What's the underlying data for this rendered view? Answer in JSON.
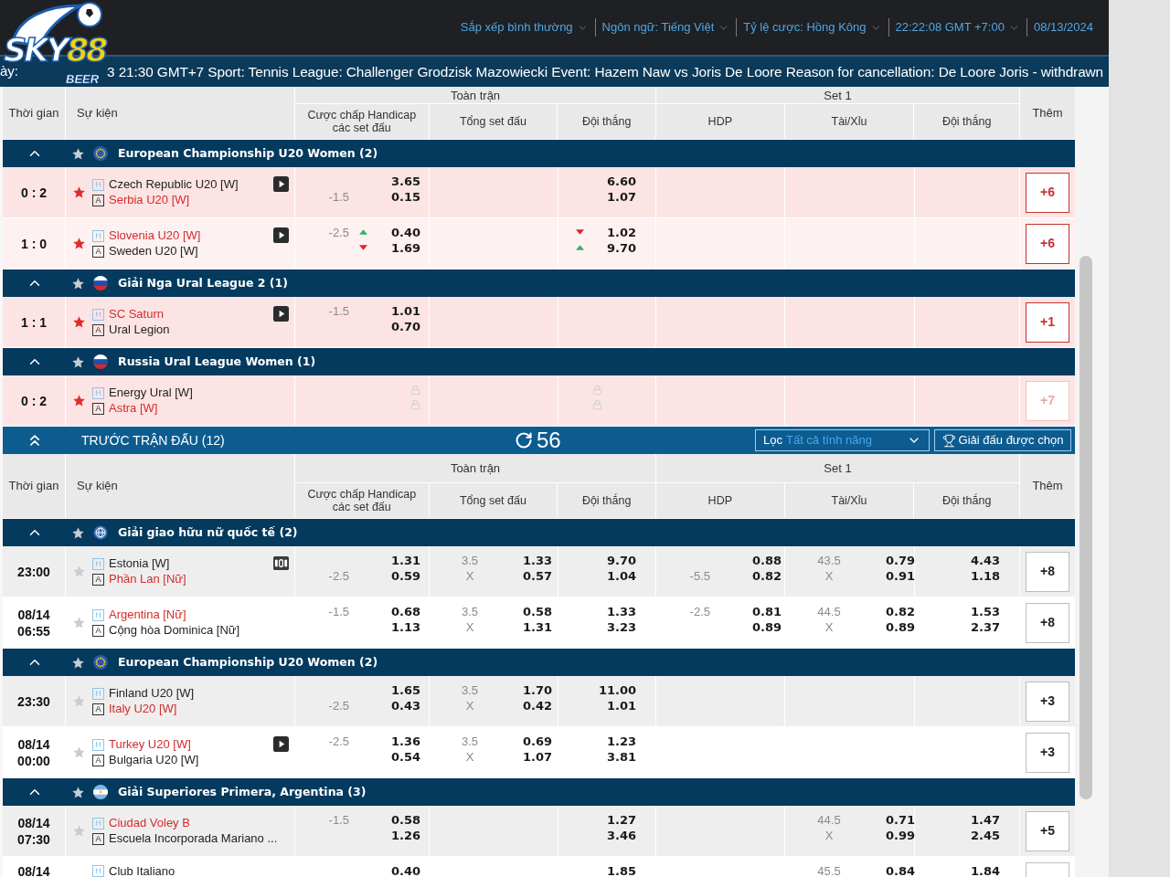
{
  "logo": {
    "brand": "SKY",
    "number": "88",
    "tagline": "BEER"
  },
  "top_menu": [
    {
      "label": "Sắp xếp bình thường",
      "dropdown": true
    },
    {
      "label": "Ngôn ngữ: Tiếng Việt",
      "dropdown": true
    },
    {
      "label": "Tỷ lệ cược: Hồng Kông",
      "dropdown": true
    },
    {
      "label": "22:22:08 GMT +7:00",
      "dropdown": true
    },
    {
      "label": "08/13/2024",
      "dropdown": false
    }
  ],
  "ticker": {
    "lead": "ày:",
    "text": "3 21:30 GMT+7 Sport: Tennis League: Challenger Grodzisk Mazowiecki Event: Hazem Naw vs Joris De Loore Reason for cancellation: De Loore Joris - withdrawn"
  },
  "sections": [
    {
      "kind": "live",
      "header": {
        "time": "Thời gian",
        "event": "Sự kiện",
        "groups": [
          {
            "label": "Toàn trận",
            "columns": [
              "Cược chấp Handicap các set đấu",
              "Tổng set đấu",
              "Đội thắng"
            ]
          },
          {
            "label": "Set 1",
            "columns": [
              "HDP",
              "Tài/Xỉu",
              "Đội thắng"
            ]
          }
        ],
        "more": "Thêm"
      },
      "leagues": [
        {
          "title": "European Championship U20 Women (2)",
          "flag": {
            "kind": "eu"
          },
          "matches": [
            {
              "score": "0 : 2",
              "starred": true,
              "media": {
                "kind": "video"
              },
              "teams": [
                {
                  "tag": "H",
                  "name": "Czech Republic U20 [W]",
                  "favorite": false
                },
                {
                  "tag": "A",
                  "name": "Serbia U20 [W]",
                  "favorite": true
                }
              ],
              "ft_hdp": {
                "line_away": "-1.5",
                "odds": [
                  {
                    "value": "3.65"
                  },
                  {
                    "value": "0.15"
                  }
                ]
              },
              "ft_win": {
                "odds": [
                  {
                    "value": "6.60"
                  },
                  {
                    "value": "1.07"
                  }
                ]
              },
              "more": {
                "label": "+6",
                "disabled": false
              }
            },
            {
              "score": "1 : 0",
              "starred": true,
              "media": {
                "kind": "video"
              },
              "teams": [
                {
                  "tag": "H",
                  "name": "Slovenia U20 [W]",
                  "favorite": true
                },
                {
                  "tag": "A",
                  "name": "Sweden U20 [W]",
                  "favorite": false
                }
              ],
              "ft_hdp": {
                "line_home": "-2.5",
                "odds": [
                  {
                    "value": "0.40",
                    "rising": true
                  },
                  {
                    "value": "1.69",
                    "falling": true
                  }
                ]
              },
              "ft_win": {
                "odds": [
                  {
                    "value": "1.02",
                    "falling": true
                  },
                  {
                    "value": "9.70",
                    "rising": true
                  }
                ]
              },
              "more": {
                "label": "+6",
                "disabled": false
              }
            }
          ]
        },
        {
          "title": "Giải Nga Ural League 2 (1)",
          "flag": {
            "kind": "ru"
          },
          "matches": [
            {
              "score": "1 : 1",
              "starred": true,
              "media": {
                "kind": "video"
              },
              "teams": [
                {
                  "tag": "H",
                  "name": "SC Saturn",
                  "favorite": true
                },
                {
                  "tag": "A",
                  "name": "Ural Legion",
                  "favorite": false
                }
              ],
              "ft_hdp": {
                "line_home": "-1.5",
                "odds": [
                  {
                    "value": "1.01"
                  },
                  {
                    "value": "0.70"
                  }
                ]
              },
              "more": {
                "label": "+1",
                "disabled": false
              }
            }
          ]
        },
        {
          "title": "Russia Ural League Women (1)",
          "flag": {
            "kind": "ru"
          },
          "matches": [
            {
              "score": "0 : 2",
              "starred": true,
              "teams": [
                {
                  "tag": "H",
                  "name": "Energy Ural [W]",
                  "favorite": false
                },
                {
                  "tag": "A",
                  "name": "Astra [W]",
                  "favorite": true
                }
              ],
              "ft_hdp": {
                "locked": true
              },
              "ft_win": {
                "locked": true
              },
              "more": {
                "label": "+7",
                "disabled": true
              }
            }
          ]
        }
      ]
    },
    {
      "kind": "upcoming",
      "bar": {
        "title": "TRƯỚC TRẬN ĐẤU (12)",
        "refresh": "56",
        "filter": {
          "label": "Lọc",
          "value": "Tất cả tính năng"
        },
        "leagues_button": "Giải đấu được chọn"
      },
      "header": {
        "time": "Thời gian",
        "event": "Sự kiện",
        "groups": [
          {
            "label": "Toàn trận",
            "columns": [
              "Cược chấp Handicap các set đấu",
              "Tổng set đấu",
              "Đội thắng"
            ]
          },
          {
            "label": "Set 1",
            "columns": [
              "HDP",
              "Tài/Xỉu",
              "Đội thắng"
            ]
          }
        ],
        "more": "Thêm"
      },
      "leagues": [
        {
          "title": "Giải giao hữu nữ quốc tế (2)",
          "flag": {
            "kind": "globe"
          },
          "matches": [
            {
              "start": [
                "23:00"
              ],
              "starred": false,
              "media": {
                "kind": "stats"
              },
              "teams": [
                {
                  "tag": "H",
                  "name": "Estonia [W]",
                  "favorite": false
                },
                {
                  "tag": "A",
                  "name": "Phần Lan [Nữ]",
                  "favorite": true
                }
              ],
              "ft_hdp": {
                "line_away": "-2.5",
                "odds": [
                  {
                    "value": "1.31"
                  },
                  {
                    "value": "0.59"
                  }
                ]
              },
              "ft_total": {
                "line": "3.5",
                "mark": "X",
                "odds": [
                  {
                    "value": "1.33"
                  },
                  {
                    "value": "0.57"
                  }
                ]
              },
              "ft_win": {
                "odds": [
                  {
                    "value": "9.70"
                  },
                  {
                    "value": "1.04"
                  }
                ]
              },
              "s1_hdp": {
                "line_away": "-5.5",
                "odds": [
                  {
                    "value": "0.88"
                  },
                  {
                    "value": "0.82"
                  }
                ]
              },
              "s1_total": {
                "line": "43.5",
                "mark": "X",
                "odds": [
                  {
                    "value": "0.79"
                  },
                  {
                    "value": "0.91"
                  }
                ]
              },
              "s1_win": {
                "odds": [
                  {
                    "value": "4.43"
                  },
                  {
                    "value": "1.18"
                  }
                ]
              },
              "more": {
                "label": "+8",
                "disabled": false
              }
            },
            {
              "start": [
                "08/14",
                "06:55"
              ],
              "starred": false,
              "teams": [
                {
                  "tag": "H",
                  "name": "Argentina [Nữ]",
                  "favorite": true
                },
                {
                  "tag": "A",
                  "name": "Cộng hòa Dominica [Nữ]",
                  "favorite": false
                }
              ],
              "ft_hdp": {
                "line_home": "-1.5",
                "odds": [
                  {
                    "value": "0.68"
                  },
                  {
                    "value": "1.13"
                  }
                ]
              },
              "ft_total": {
                "line": "3.5",
                "mark": "X",
                "odds": [
                  {
                    "value": "0.58"
                  },
                  {
                    "value": "1.31"
                  }
                ]
              },
              "ft_win": {
                "odds": [
                  {
                    "value": "1.33"
                  },
                  {
                    "value": "3.23"
                  }
                ]
              },
              "s1_hdp": {
                "line_home": "-2.5",
                "odds": [
                  {
                    "value": "0.81"
                  },
                  {
                    "value": "0.89"
                  }
                ]
              },
              "s1_total": {
                "line": "44.5",
                "mark": "X",
                "odds": [
                  {
                    "value": "0.82"
                  },
                  {
                    "value": "0.89"
                  }
                ]
              },
              "s1_win": {
                "odds": [
                  {
                    "value": "1.53"
                  },
                  {
                    "value": "2.37"
                  }
                ]
              },
              "more": {
                "label": "+8",
                "disabled": false
              }
            }
          ]
        },
        {
          "title": "European Championship U20 Women (2)",
          "flag": {
            "kind": "eu"
          },
          "matches": [
            {
              "start": [
                "23:30"
              ],
              "starred": false,
              "teams": [
                {
                  "tag": "H",
                  "name": "Finland U20 [W]",
                  "favorite": false
                },
                {
                  "tag": "A",
                  "name": "Italy U20 [W]",
                  "favorite": true
                }
              ],
              "ft_hdp": {
                "line_away": "-2.5",
                "odds": [
                  {
                    "value": "1.65"
                  },
                  {
                    "value": "0.43"
                  }
                ]
              },
              "ft_total": {
                "line": "3.5",
                "mark": "X",
                "odds": [
                  {
                    "value": "1.70"
                  },
                  {
                    "value": "0.42"
                  }
                ]
              },
              "ft_win": {
                "odds": [
                  {
                    "value": "11.00"
                  },
                  {
                    "value": "1.01"
                  }
                ]
              },
              "more": {
                "label": "+3",
                "disabled": false
              }
            },
            {
              "start": [
                "08/14",
                "00:00"
              ],
              "starred": false,
              "media": {
                "kind": "video"
              },
              "teams": [
                {
                  "tag": "H",
                  "name": "Turkey U20 [W]",
                  "favorite": true
                },
                {
                  "tag": "A",
                  "name": "Bulgaria U20 [W]",
                  "favorite": false
                }
              ],
              "ft_hdp": {
                "line_home": "-2.5",
                "odds": [
                  {
                    "value": "1.36"
                  },
                  {
                    "value": "0.54"
                  }
                ]
              },
              "ft_total": {
                "line": "3.5",
                "mark": "X",
                "odds": [
                  {
                    "value": "0.69"
                  },
                  {
                    "value": "1.07"
                  }
                ]
              },
              "ft_win": {
                "odds": [
                  {
                    "value": "1.23"
                  },
                  {
                    "value": "3.81"
                  }
                ]
              },
              "more": {
                "label": "+3",
                "disabled": false
              }
            }
          ]
        },
        {
          "title": "Giải Superiores Primera, Argentina (3)",
          "flag": {
            "kind": "ar"
          },
          "matches": [
            {
              "start": [
                "08/14",
                "07:30"
              ],
              "starred": false,
              "teams": [
                {
                  "tag": "H",
                  "name": "Ciudad Voley B",
                  "favorite": true
                },
                {
                  "tag": "A",
                  "name": "Escuela Incorporada Mariano ...",
                  "favorite": false
                }
              ],
              "ft_hdp": {
                "line_home": "-1.5",
                "odds": [
                  {
                    "value": "0.58"
                  },
                  {
                    "value": "1.26"
                  }
                ]
              },
              "ft_win": {
                "odds": [
                  {
                    "value": "1.27"
                  },
                  {
                    "value": "3.46"
                  }
                ]
              },
              "s1_total": {
                "line": "44.5",
                "mark": "X",
                "odds": [
                  {
                    "value": "0.71"
                  },
                  {
                    "value": "0.99"
                  }
                ]
              },
              "s1_win": {
                "odds": [
                  {
                    "value": "1.47"
                  },
                  {
                    "value": "2.45"
                  }
                ]
              },
              "more": {
                "label": "+5",
                "disabled": false
              }
            },
            {
              "start": [
                "08/14"
              ],
              "teams": [
                {
                  "tag": "H",
                  "name": "Club Italiano",
                  "favorite": false
                }
              ],
              "ft_hdp": {
                "odds": [
                  {
                    "value": "0.40"
                  }
                ]
              },
              "ft_win": {
                "odds": [
                  {
                    "value": "1.85"
                  }
                ]
              },
              "s1_total": {
                "line": "45.5",
                "odds": [
                  {
                    "value": "0.84"
                  }
                ]
              },
              "s1_win": {
                "odds": [
                  {
                    "value": "1.84"
                  }
                ]
              },
              "more": {
                "disabled": false
              }
            }
          ]
        }
      ]
    }
  ]
}
